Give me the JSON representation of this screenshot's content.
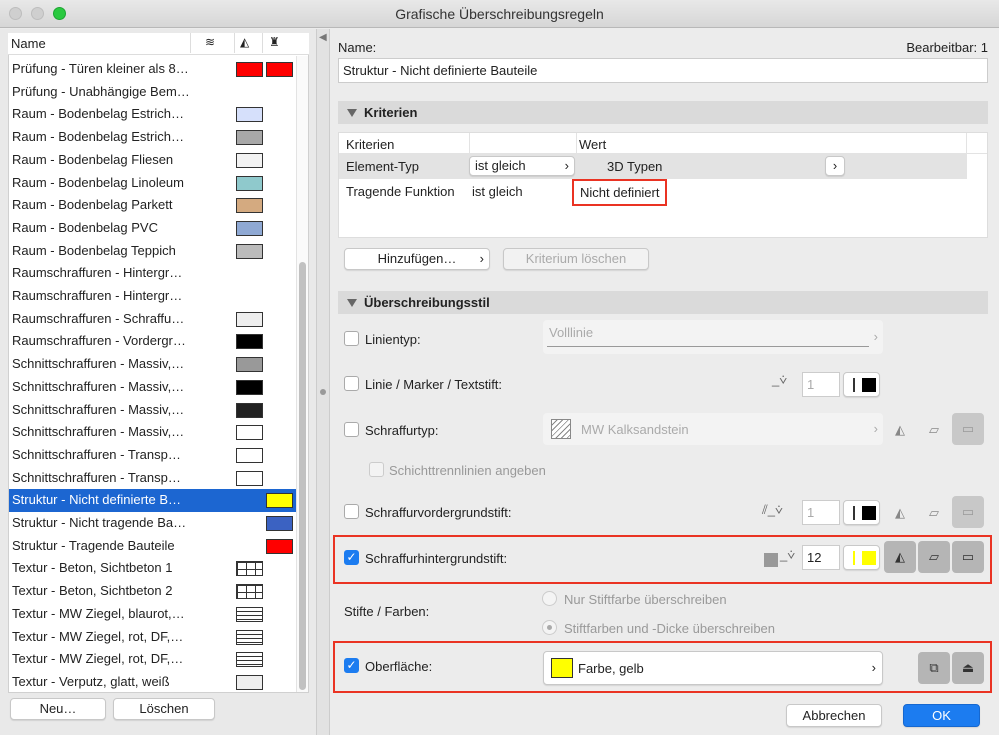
{
  "window": {
    "title": "Grafische Überschreibungsregeln"
  },
  "list": {
    "header": {
      "name": "Name",
      "icons": [
        "surface-icon",
        "fill-icon",
        "brush-icon"
      ]
    },
    "items": [
      {
        "label": "Prüfung - Türen kleiner als 8…",
        "c1": "#ff0000",
        "c2": "#ff0000"
      },
      {
        "label": "Prüfung - Unabhängige Bem…"
      },
      {
        "label": "Raum - Bodenbelag Estrich…",
        "c1": "#d6e0fb"
      },
      {
        "label": "Raum - Bodenbelag Estrich…",
        "c1": "#a8a8a8"
      },
      {
        "label": "Raum - Bodenbelag Fliesen",
        "c1": "#f2f2f2"
      },
      {
        "label": "Raum - Bodenbelag Linoleum",
        "c1": "#8fc9cc"
      },
      {
        "label": "Raum - Bodenbelag Parkett",
        "c1": "#d4aa80"
      },
      {
        "label": "Raum - Bodenbelag PVC",
        "c1": "#8fa9d4"
      },
      {
        "label": "Raum - Bodenbelag Teppich",
        "c1": "#bbbbbb"
      },
      {
        "label": "Raumschraffuren - Hintergr…"
      },
      {
        "label": "Raumschraffuren - Hintergr…"
      },
      {
        "label": "Raumschraffuren - Schraffu…",
        "c1": "#eeeeee"
      },
      {
        "label": "Raumschraffuren - Vordergr…",
        "c1": "#000000"
      },
      {
        "label": "Schnittschraffuren - Massiv,…",
        "c1": "#999999"
      },
      {
        "label": "Schnittschraffuren - Massiv,…",
        "c1": "#000000"
      },
      {
        "label": "Schnittschraffuren - Massiv,…",
        "c1": "#222222"
      },
      {
        "label": "Schnittschraffuren - Massiv,…",
        "c1": "#ffffff"
      },
      {
        "label": "Schnittschraffuren - Transp…",
        "c1": "#ffffff"
      },
      {
        "label": "Schnittschraffuren - Transp…",
        "c1": "#ffffff"
      },
      {
        "label": "Struktur - Nicht definierte B…",
        "c2": "#ffff00",
        "selected": true
      },
      {
        "label": "Struktur - Nicht tragende Ba…",
        "c2": "#3b62c2"
      },
      {
        "label": "Struktur - Tragende Bauteile",
        "c2": "#ff0000"
      },
      {
        "label": "Textur - Beton, Sichtbeton 1",
        "c1": "grid"
      },
      {
        "label": "Textur - Beton, Sichtbeton 2",
        "c1": "grid"
      },
      {
        "label": "Textur - MW Ziegel, blaurot,…",
        "c1": "brick"
      },
      {
        "label": "Textur - MW Ziegel, rot, DF,…",
        "c1": "brick"
      },
      {
        "label": "Textur - MW Ziegel, rot, DF,…",
        "c1": "brick"
      },
      {
        "label": "Textur - Verputz, glatt, weiß",
        "c1": "#eeeeee"
      }
    ],
    "new_button": "Neu…",
    "delete_button": "Löschen"
  },
  "form": {
    "name_label": "Name:",
    "editable": "Bearbeitbar: 1",
    "name_value": "Struktur - Nicht definierte Bauteile",
    "criteria": {
      "title": "Kriterien",
      "col_criteria": "Kriterien",
      "col_value": "Wert",
      "rows": [
        {
          "criterion": "Element-Typ",
          "operator": "ist gleich",
          "value": "3D Typen"
        },
        {
          "criterion": "Tragende Funktion",
          "operator": "ist gleich",
          "value": "Nicht definiert"
        }
      ],
      "add_button": "Hinzufügen…",
      "delete_button": "Kriterium löschen"
    },
    "style": {
      "title": "Überschreibungsstil",
      "linetype_label": "Linientyp:",
      "linetype_value": "Volllinie",
      "pen_label": "Linie / Marker / Textstift:",
      "pen_value": "1",
      "filltype_label": "Schraffurtyp:",
      "filltype_value": "MW Kalksandstein",
      "layer_lines_label": "Schichttrennlinien angeben",
      "fg_pen_label": "Schraffurvordergrundstift:",
      "fg_pen_value": "1",
      "bg_pen_label": "Schraffurhintergrundstift:",
      "bg_pen_value": "12",
      "bg_pen_color": "#ffff00",
      "pens_label": "Stifte / Farben:",
      "radio1": "Nur Stiftfarbe überschreiben",
      "radio2": "Stiftfarben und -Dicke überschreiben",
      "surface_label": "Oberfläche:",
      "surface_value": "Farbe, gelb",
      "surface_color": "#ffff00"
    },
    "cancel_button": "Abbrechen",
    "ok_button": "OK"
  }
}
